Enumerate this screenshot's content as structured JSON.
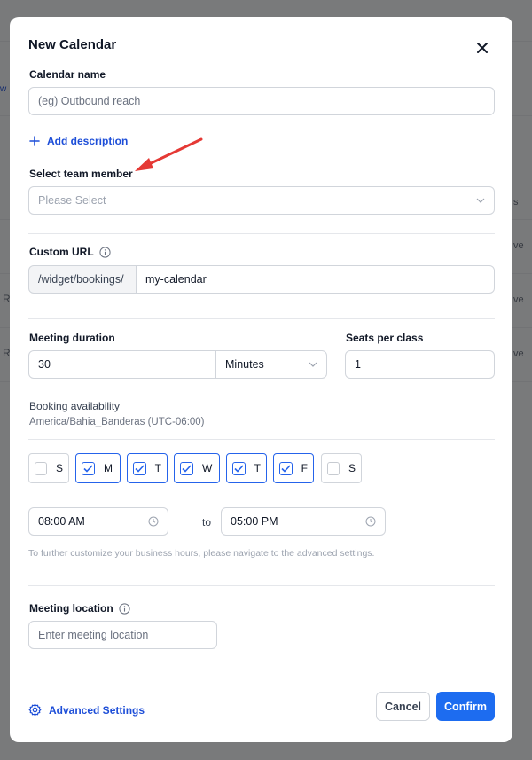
{
  "background": {
    "fragments": [
      "w",
      "s",
      "ve",
      "ve",
      "ve",
      "R",
      "R"
    ]
  },
  "modal": {
    "title": "New Calendar",
    "calendar_name": {
      "label": "Calendar name",
      "placeholder": "(eg) Outbound reach"
    },
    "add_description": "Add description",
    "team_member": {
      "label": "Select team member",
      "placeholder": "Please Select"
    },
    "custom_url": {
      "label": "Custom URL",
      "prefix": "/widget/bookings/",
      "value": "my-calendar"
    },
    "meeting_duration": {
      "label": "Meeting duration",
      "value": "30",
      "unit": "Minutes"
    },
    "seats": {
      "label": "Seats per class",
      "value": "1"
    },
    "availability": {
      "label": "Booking availability",
      "timezone": "America/Bahia_Banderas (UTC-06:00)",
      "days": [
        {
          "label": "S",
          "checked": false
        },
        {
          "label": "M",
          "checked": true
        },
        {
          "label": "T",
          "checked": true
        },
        {
          "label": "W",
          "checked": true
        },
        {
          "label": "T",
          "checked": true
        },
        {
          "label": "F",
          "checked": true
        },
        {
          "label": "S",
          "checked": false
        }
      ],
      "start_time": "08:00 AM",
      "to_label": "to",
      "end_time": "05:00 PM",
      "hint": "To further customize your business hours, please navigate to the advanced settings."
    },
    "location": {
      "label": "Meeting location",
      "placeholder": "Enter meeting location"
    },
    "advanced_settings": "Advanced Settings",
    "cancel": "Cancel",
    "confirm": "Confirm"
  },
  "colors": {
    "primary": "#1d6cf0",
    "link": "#1d4ed8",
    "annotation_arrow": "#e53935"
  }
}
